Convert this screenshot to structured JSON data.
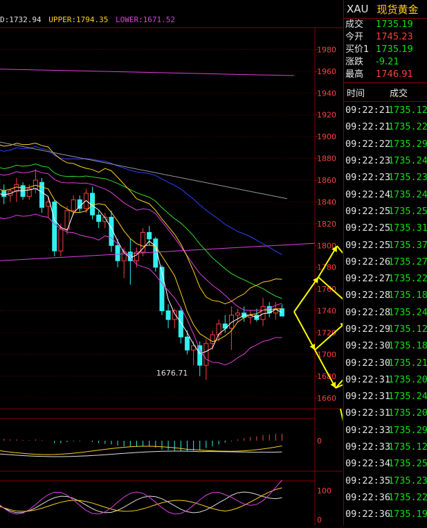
{
  "indicator_line": {
    "mid": "D:1732.94",
    "upper": "UPPER:1794.35",
    "lower": "LOWER:1671.52",
    "colors": {
      "mid": "#e0e0e0",
      "upper": "#ffd21f",
      "lower": "#e040e0"
    }
  },
  "instrument": {
    "code": "XAU",
    "name": "现货黄金"
  },
  "quote": [
    {
      "label": "成交",
      "value": "1735.19",
      "color": "green"
    },
    {
      "label": "今开",
      "value": "1745.23",
      "color": "red"
    },
    {
      "label": "买价1",
      "value": "1735.19",
      "color": "green"
    },
    {
      "label": "涨跌",
      "value": "-9.21",
      "color": "green"
    },
    {
      "label": "最高",
      "value": "1746.91",
      "color": "red"
    }
  ],
  "ticks_header": {
    "time": "时间",
    "price": "成交"
  },
  "ticks": [
    {
      "time": "09:22:21",
      "price": "1735.12"
    },
    {
      "time": "09:22:21",
      "price": "1735.22"
    },
    {
      "time": "09:22:22",
      "price": "1735.29"
    },
    {
      "time": "09:22:23",
      "price": "1735.24"
    },
    {
      "time": "09:22:23",
      "price": "1735.23"
    },
    {
      "time": "09:22:24",
      "price": "1735.24"
    },
    {
      "time": "09:22:25",
      "price": "1735.25"
    },
    {
      "time": "09:22:25",
      "price": "1735.31"
    },
    {
      "time": "09:22:25",
      "price": "1735.37"
    },
    {
      "time": "09:22:26",
      "price": "1735.27"
    },
    {
      "time": "09:22:27",
      "price": "1735.22"
    },
    {
      "time": "09:22:28",
      "price": "1735.18"
    },
    {
      "time": "09:22:28",
      "price": "1735.24"
    },
    {
      "time": "09:22:29",
      "price": "1735.12"
    },
    {
      "time": "09:22:30",
      "price": "1735.18"
    },
    {
      "time": "09:22:30",
      "price": "1735.21"
    },
    {
      "time": "09:22:31",
      "price": "1735.20"
    },
    {
      "time": "09:22:31",
      "price": "1735.24"
    },
    {
      "time": "09:22:31",
      "price": "1735.20"
    },
    {
      "time": "09:22:33",
      "price": "1735.29"
    },
    {
      "time": "09:22:33",
      "price": "1735.12"
    },
    {
      "time": "09:22:34",
      "price": "1735.25"
    },
    {
      "time": "09:22:35",
      "price": "1735.23"
    },
    {
      "time": "09:22:36",
      "price": "1735.22"
    },
    {
      "time": "09:22:36",
      "price": "1735.19"
    }
  ],
  "main_axis": {
    "ylim": [
      1650,
      2000
    ],
    "ticks": [
      1980,
      1960,
      1940,
      1920,
      1900,
      1880,
      1860,
      1840,
      1820,
      1800,
      1780,
      1760,
      1740,
      1720,
      1700,
      1680,
      1660
    ]
  },
  "low_annotation": "1676.71",
  "macd_axis_label": "0",
  "kdj_axis_labels": [
    "100",
    "0"
  ],
  "candles": [
    [
      1860,
      1865,
      1840,
      1848
    ],
    [
      1850,
      1856,
      1838,
      1845
    ],
    [
      1846,
      1852,
      1840,
      1850
    ],
    [
      1850,
      1862,
      1840,
      1856
    ],
    [
      1855,
      1858,
      1842,
      1845
    ],
    [
      1845,
      1856,
      1842,
      1852
    ],
    [
      1852,
      1870,
      1848,
      1860
    ],
    [
      1858,
      1862,
      1830,
      1835
    ],
    [
      1836,
      1845,
      1826,
      1840
    ],
    [
      1840,
      1842,
      1790,
      1795
    ],
    [
      1795,
      1820,
      1790,
      1815
    ],
    [
      1815,
      1836,
      1810,
      1832
    ],
    [
      1832,
      1846,
      1828,
      1842
    ],
    [
      1842,
      1846,
      1830,
      1834
    ],
    [
      1834,
      1852,
      1830,
      1848
    ],
    [
      1848,
      1854,
      1824,
      1828
    ],
    [
      1828,
      1832,
      1816,
      1822
    ],
    [
      1822,
      1830,
      1816,
      1826
    ],
    [
      1826,
      1832,
      1794,
      1800
    ],
    [
      1800,
      1806,
      1780,
      1786
    ],
    [
      1786,
      1798,
      1770,
      1794
    ],
    [
      1794,
      1806,
      1764,
      1786
    ],
    [
      1786,
      1798,
      1780,
      1794
    ],
    [
      1794,
      1816,
      1790,
      1812
    ],
    [
      1812,
      1818,
      1800,
      1806
    ],
    [
      1806,
      1808,
      1776,
      1780
    ],
    [
      1780,
      1782,
      1736,
      1740
    ],
    [
      1740,
      1746,
      1724,
      1732
    ],
    [
      1732,
      1742,
      1724,
      1740
    ],
    [
      1740,
      1744,
      1710,
      1716
    ],
    [
      1716,
      1722,
      1700,
      1704
    ],
    [
      1704,
      1712,
      1690,
      1708
    ],
    [
      1708,
      1712,
      1680,
      1690
    ],
    [
      1690,
      1714,
      1676.71,
      1710
    ],
    [
      1710,
      1722,
      1704,
      1718
    ],
    [
      1718,
      1732,
      1712,
      1728
    ],
    [
      1728,
      1736,
      1720,
      1724
    ],
    [
      1724,
      1744,
      1704,
      1736
    ],
    [
      1736,
      1742,
      1730,
      1738
    ],
    [
      1738,
      1744,
      1730,
      1734
    ],
    [
      1734,
      1740,
      1728,
      1736
    ],
    [
      1736,
      1742,
      1730,
      1732
    ],
    [
      1732,
      1752,
      1726,
      1744
    ],
    [
      1744,
      1748,
      1734,
      1738
    ],
    [
      1738,
      1748,
      1732,
      1742
    ],
    [
      1742,
      1746,
      1735,
      1735.19
    ]
  ],
  "macd_hist": [
    0.2,
    0.15,
    0.1,
    0.1,
    0.05,
    0.05,
    0.1,
    0.05,
    0.0,
    -0.2,
    -0.2,
    -0.1,
    -0.05,
    -0.05,
    0.0,
    -0.1,
    -0.2,
    -0.25,
    -0.3,
    -0.4,
    -0.45,
    -0.5,
    -0.5,
    -0.45,
    -0.45,
    -0.55,
    -0.7,
    -0.75,
    -0.8,
    -0.85,
    -0.85,
    -0.8,
    -0.75,
    -0.6,
    -0.45,
    -0.3,
    -0.15,
    -0.05,
    0.1,
    0.2,
    0.3,
    0.35,
    0.45,
    0.5,
    0.55,
    0.55
  ],
  "colors": {
    "axis": "#8b0000",
    "up": "#ff4040",
    "down": "#30f0f0",
    "mid": "#e0e0e0",
    "upper": "#ffd21f",
    "lower": "#e040e0",
    "ma1": "#ffffff",
    "ma2": "#ffd21f",
    "ma3": "#e040e0",
    "ma4": "#30e030",
    "ma5": "#3040ff",
    "ma6": "#9a9a9a",
    "arrow": "#ffff00"
  }
}
